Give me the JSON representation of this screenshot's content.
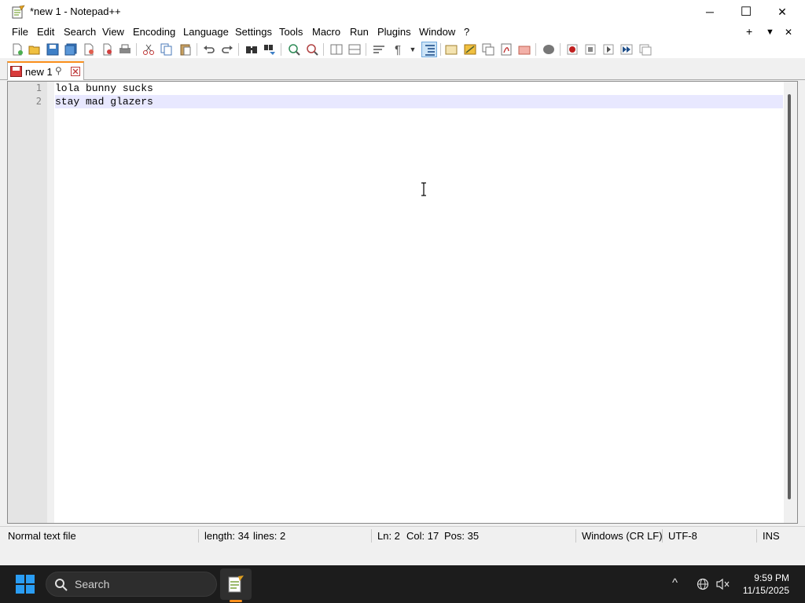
{
  "window": {
    "title": "*new 1 - Notepad++",
    "minimize_glyph": "─",
    "maximize_glyph": "☐",
    "close_glyph": "✕"
  },
  "menu": {
    "items": [
      "File",
      "Edit",
      "Search",
      "View",
      "Encoding",
      "Language",
      "Settings",
      "Tools",
      "Macro",
      "Run",
      "Plugins",
      "Window",
      "?"
    ],
    "right": {
      "add": "+",
      "dropdown": "▼",
      "close": "✕"
    }
  },
  "toolbar": {
    "icons": [
      "new-file-icon",
      "open-file-icon",
      "save-icon",
      "save-all-icon",
      "close-icon",
      "close-all-icon",
      "print-icon",
      "cut-icon",
      "copy-icon",
      "paste-icon",
      "undo-icon",
      "redo-icon",
      "find-icon",
      "replace-icon",
      "zoom-in-icon",
      "zoom-out-icon",
      "sync-vertical-icon",
      "sync-horizontal-icon",
      "word-wrap-icon",
      "show-all-characters-icon",
      "indent-guide-icon",
      "language-icon",
      "folder-as-workspace-icon",
      "function-list-icon",
      "document-map-icon",
      "doc-list-icon",
      "speech-bubble-icon",
      "record-macro-icon",
      "stop-macro-icon",
      "play-macro-icon",
      "run-macro-multiple-icon",
      "save-macro-icon"
    ],
    "pilcrow": "¶"
  },
  "tab": {
    "label": "new 1",
    "pin_glyph": "📌",
    "accent": "#fa8f1b"
  },
  "editor": {
    "lines": [
      {
        "number": "1",
        "text": "lola bunny sucks"
      },
      {
        "number": "2",
        "text": "stay mad glazers"
      }
    ],
    "active_line": 2,
    "active_line_color": "#e8e8ff"
  },
  "status": {
    "file_type": "Normal text file",
    "length": "length: 34",
    "lines": "lines: 2",
    "ln": "Ln: 2",
    "col": "Col: 17",
    "pos": "Pos: 35",
    "eol": "Windows (CR LF)",
    "encoding": "UTF-8",
    "mode": "INS"
  },
  "taskbar": {
    "search_label": "Search",
    "time": "9:59 PM",
    "date": "11/15/2025",
    "tray_chevron": "^"
  }
}
